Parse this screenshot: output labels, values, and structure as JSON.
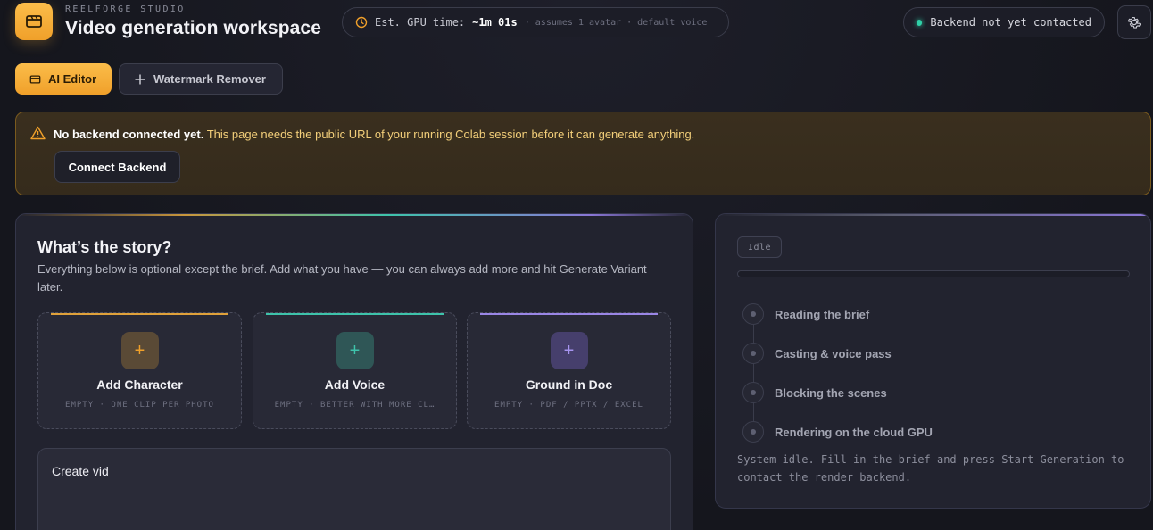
{
  "header": {
    "brand_sub": "REELFORGE STUDIO",
    "title": "Video generation workspace",
    "gpu_label": "Est. GPU time:",
    "gpu_value": "~1m 01s",
    "gpu_note": "· assumes 1 avatar · default voice",
    "status_text": "Backend not yet contacted",
    "icons": {
      "logo": "clapperboard-icon",
      "settings": "gear-icon",
      "clock": "clock-icon"
    }
  },
  "tabs": [
    {
      "label": "AI Editor",
      "icon": "clapperboard-icon",
      "active": true
    },
    {
      "label": "Watermark Remover",
      "icon": "plus-icon",
      "active": false
    }
  ],
  "warning": {
    "strong": "No backend connected yet.",
    "body": " This page needs the public URL of your running Colab session before it can generate anything.",
    "button": "Connect Backend"
  },
  "story": {
    "title": "What’s the story?",
    "description": "Everything below is optional except the brief. Add what you have — you can always add more and hit Generate Variant later.",
    "tiles": [
      {
        "title": "Add Character",
        "meta": "EMPTY · ONE CLIP PER PHOTO",
        "icon": "plus-icon",
        "accent": "#e0a13a"
      },
      {
        "title": "Add Voice",
        "meta": "EMPTY · BETTER WITH MORE CL…",
        "icon": "plus-icon",
        "accent": "#3ec3ab"
      },
      {
        "title": "Ground in Doc",
        "meta": "EMPTY · PDF / PPTX / EXCEL",
        "icon": "plus-icon",
        "accent": "#9a86e6"
      }
    ],
    "brief_value": "Create vid"
  },
  "progress": {
    "badge": "Idle",
    "fraction": 0,
    "steps": [
      {
        "label": "Reading the brief"
      },
      {
        "label": "Casting & voice pass"
      },
      {
        "label": "Blocking the scenes"
      },
      {
        "label": "Rendering on the cloud GPU"
      }
    ],
    "message": "System idle. Fill in the brief and press Start Generation to contact the render backend."
  },
  "colors": {
    "accent_amber": "#f0a02a",
    "accent_teal": "#3ec3ab",
    "accent_violet": "#8a76d6",
    "status_green": "#2fd0a8",
    "warning_text": "#f3cf7a"
  }
}
